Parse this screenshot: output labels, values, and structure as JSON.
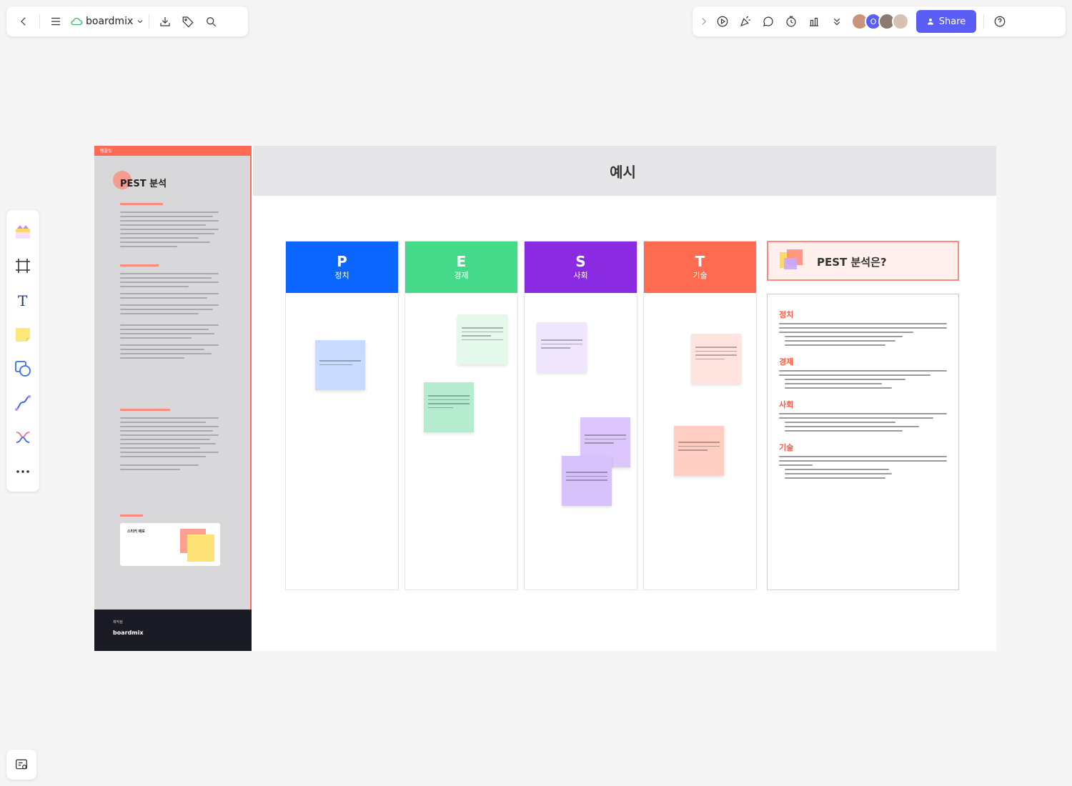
{
  "app": {
    "name": "boardmix"
  },
  "toolbar": {
    "share_label": "Share",
    "avatar_o": "O"
  },
  "board": {
    "section_title": "예시",
    "guide": {
      "tag": "템플릿",
      "title": "PEST 분석",
      "footer_label": "제작됨",
      "footer_brand": "boardmix",
      "card_title": "스티커 메모"
    },
    "columns": [
      {
        "letter": "P",
        "name": "정치",
        "color": "#0a66ff"
      },
      {
        "letter": "E",
        "name": "경제",
        "color": "#45d98a"
      },
      {
        "letter": "S",
        "name": "사회",
        "color": "#8a2be2"
      },
      {
        "letter": "T",
        "name": "기술",
        "color": "#ff6b50"
      }
    ],
    "pest_box": {
      "title": "PEST 분석은?"
    },
    "description": {
      "sections": [
        {
          "heading": "정치"
        },
        {
          "heading": "경제"
        },
        {
          "heading": "사회"
        },
        {
          "heading": "기술"
        }
      ]
    }
  },
  "colors": {
    "accent": "#5b5ef4",
    "guide_red": "#ff6b55"
  }
}
